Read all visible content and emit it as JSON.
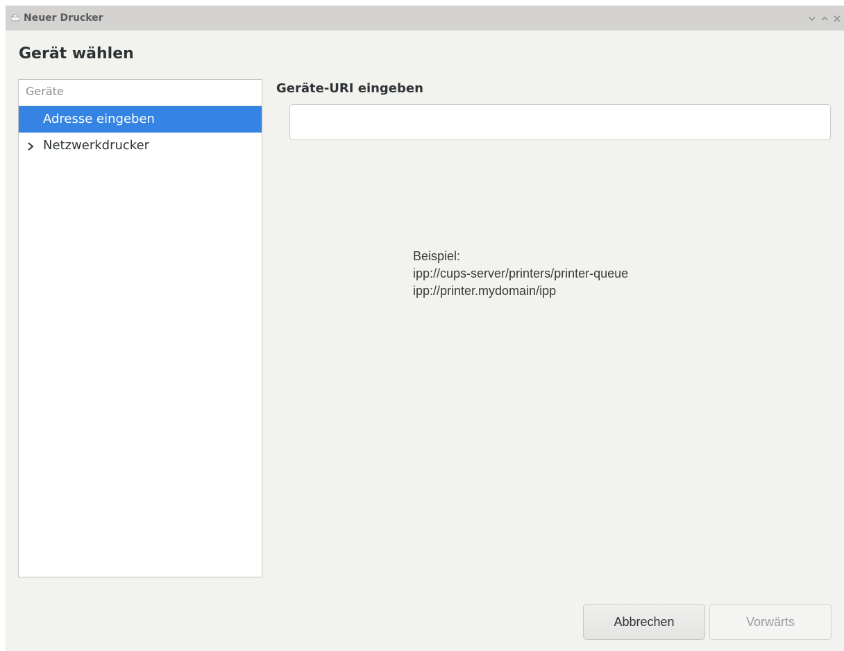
{
  "window": {
    "title": "Neuer Drucker",
    "icon": "printer-icon"
  },
  "page": {
    "heading": "Gerät wählen"
  },
  "devices": {
    "header": "Geräte",
    "items": [
      {
        "label": "Adresse eingeben",
        "selected": true,
        "expandable": false
      },
      {
        "label": "Netzwerkdrucker",
        "selected": false,
        "expandable": true
      }
    ]
  },
  "uri": {
    "label": "Geräte-URI eingeben",
    "value": "",
    "placeholder": ""
  },
  "example": {
    "lines": [
      "Beispiel:",
      "ipp://cups-server/printers/printer-queue",
      "ipp://printer.mydomain/ipp"
    ]
  },
  "buttons": {
    "cancel": "Abbrechen",
    "forward": "Vorwärts"
  },
  "colors": {
    "selection": "#3584e4",
    "window_bg": "#f2f2ef",
    "titlebar_bg": "#d4d3d1"
  }
}
